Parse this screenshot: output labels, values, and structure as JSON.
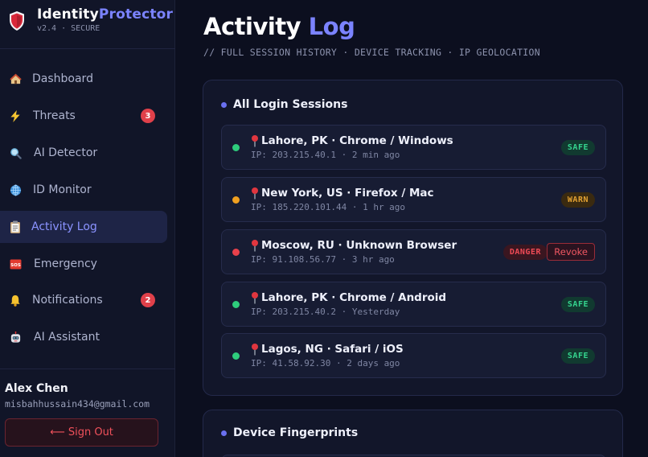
{
  "brand": {
    "name_part1": "Identity",
    "name_part2": "Protector",
    "version": "v2.4 · SECURE"
  },
  "sidebar": {
    "items": [
      {
        "label": "Dashboard",
        "icon": "house-icon"
      },
      {
        "label": "Threats",
        "icon": "lightning-icon",
        "count": "3"
      },
      {
        "label": "AI Detector",
        "icon": "magnifier-icon"
      },
      {
        "label": "ID Monitor",
        "icon": "globe-icon"
      },
      {
        "label": "Activity Log",
        "icon": "clipboard-icon",
        "active": true
      },
      {
        "label": "Emergency",
        "icon": "sos-icon"
      },
      {
        "label": "Notifications",
        "icon": "bell-icon",
        "count": "2"
      },
      {
        "label": "AI Assistant",
        "icon": "robot-icon"
      }
    ],
    "user": {
      "name": "Alex Chen",
      "email": "misbahhussain434@gmail.com"
    },
    "sign_out": "⟵ Sign Out"
  },
  "header": {
    "title_part1": "Activity",
    "title_part2": "Log",
    "subtitle": "// FULL SESSION HISTORY · DEVICE TRACKING · IP GEOLOCATION"
  },
  "sessions_card": {
    "title": "All Login Sessions",
    "sessions": [
      {
        "location": "Lahore, PK · Chrome / Windows",
        "meta": "IP: 203.215.40.1 · 2 min ago",
        "status": "SAFE",
        "status_color": "#35d58f"
      },
      {
        "location": "New York, US · Firefox / Mac",
        "meta": "IP: 185.220.101.44 · 1 hr ago",
        "status": "WARN",
        "status_color": "#e3a232"
      },
      {
        "location": "Moscow, RU · Unknown Browser",
        "meta": "IP: 91.108.56.77 · 3 hr ago",
        "status": "DANGER",
        "status_color": "#f04b56",
        "action": "Revoke"
      },
      {
        "location": "Lahore, PK · Chrome / Android",
        "meta": "IP: 203.215.40.2 · Yesterday",
        "status": "SAFE",
        "status_color": "#35d58f"
      },
      {
        "location": "Lagos, NG · Safari / iOS",
        "meta": "IP: 41.58.92.30 · 2 days ago",
        "status": "SAFE",
        "status_color": "#35d58f"
      }
    ]
  },
  "devices_card": {
    "title": "Device Fingerprints"
  },
  "colors": {
    "accent": "#7b83ff",
    "background": "#0c0f1f",
    "danger": "#f04b56"
  }
}
